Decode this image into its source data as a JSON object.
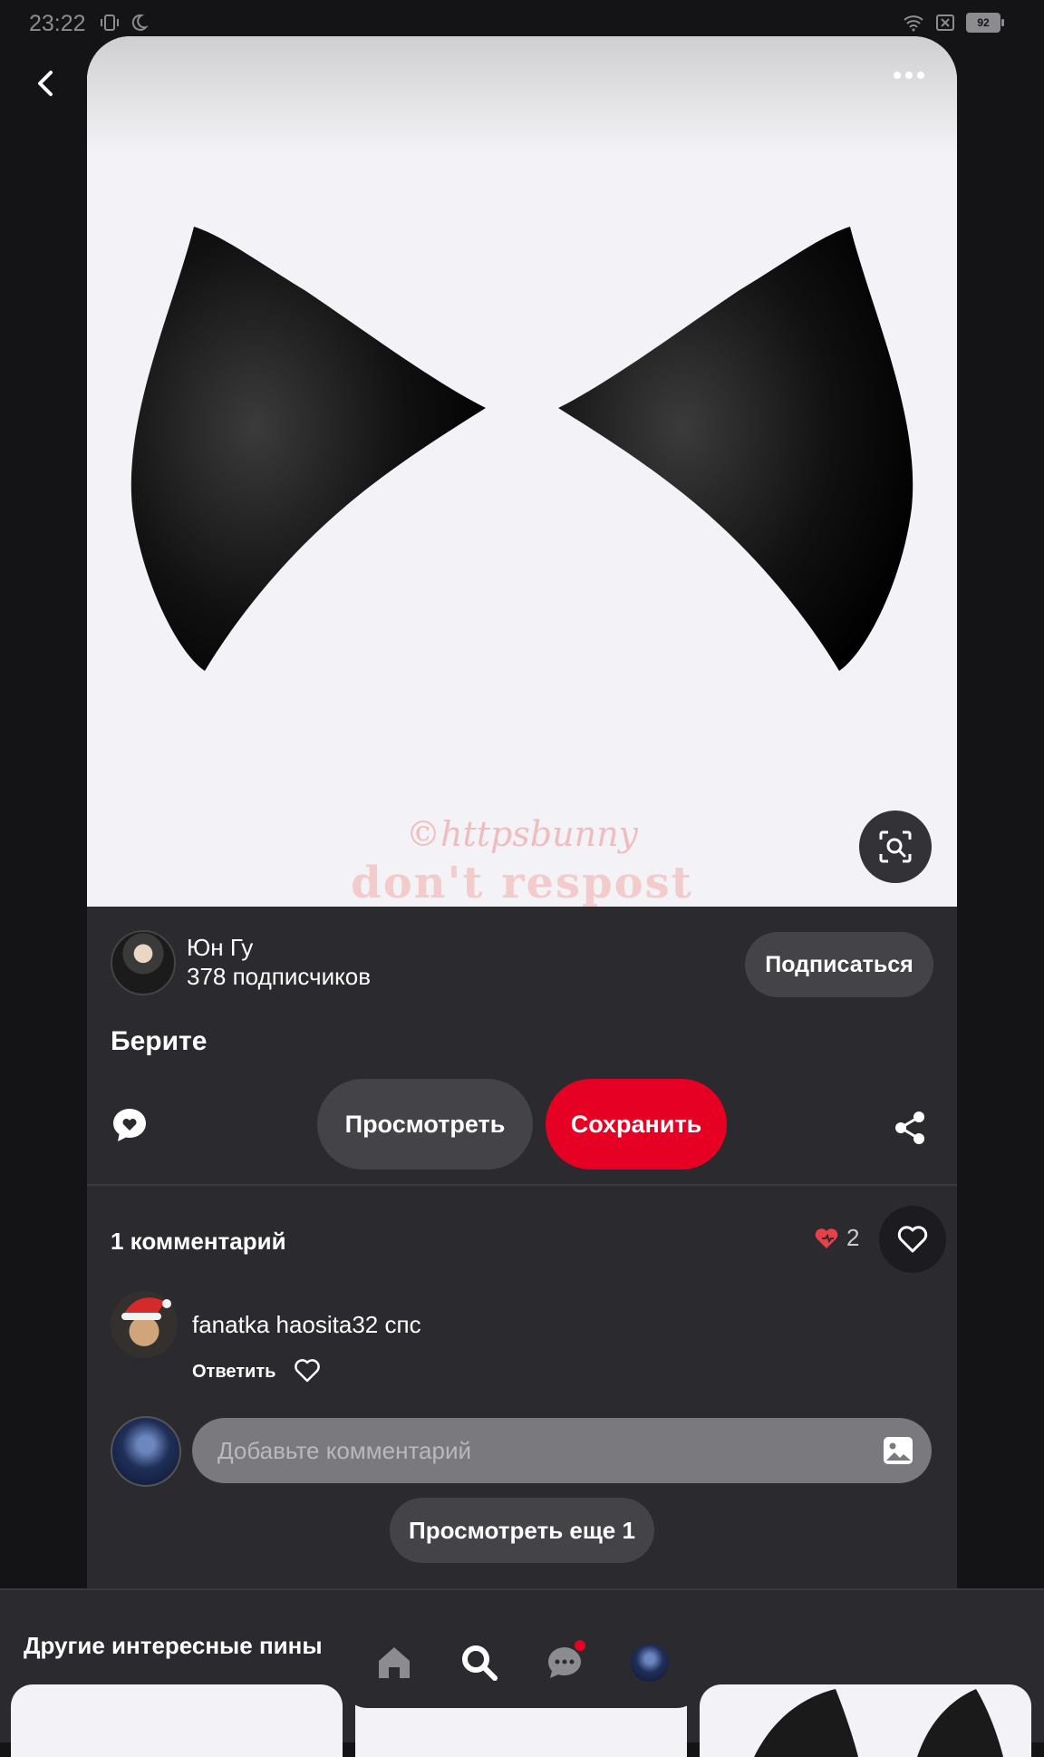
{
  "status": {
    "time": "23:22",
    "battery": "92"
  },
  "author": {
    "name": "Юн Гу",
    "followers": "378 подписчиков",
    "subscribe_label": "Подписаться"
  },
  "pin": {
    "title": "Берите",
    "watermark_line1": "©httpsbunny",
    "watermark_line2": "don't respost"
  },
  "actions": {
    "view_label": "Просмотреть",
    "save_label": "Сохранить"
  },
  "comments": {
    "count_label": "1 комментарий",
    "reactions_count": "2",
    "items": [
      {
        "user": "fanatka haosita32",
        "text": "спс",
        "reply_label": "Ответить"
      }
    ],
    "input_placeholder": "Добавьте комментарий",
    "view_more_label": "Просмотреть еще 1"
  },
  "more_pins": {
    "title": "Другие интересные пины"
  },
  "colors": {
    "accent": "#e60023",
    "card_bg": "#2b2a2e",
    "page_bg": "#141316"
  },
  "icons": [
    "back-icon",
    "more-icon",
    "visual-search-icon",
    "comment-bubble-icon",
    "share-icon",
    "heart-icon",
    "image-icon",
    "home-icon",
    "search-icon",
    "messages-icon"
  ]
}
